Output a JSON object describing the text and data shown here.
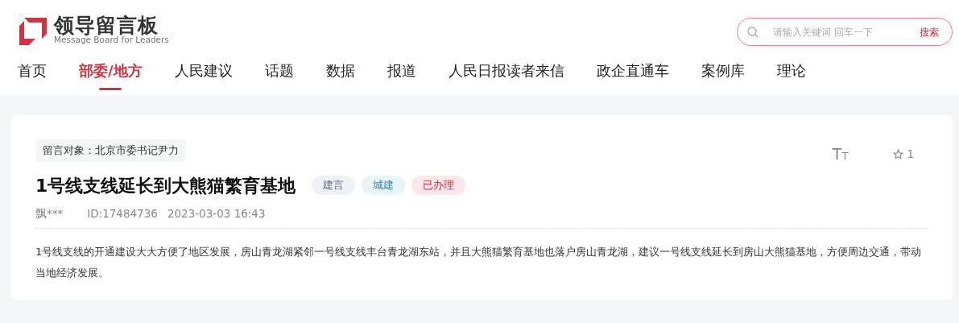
{
  "logo": {
    "title": "领导留言板",
    "subtitle": "Message Board for Leaders"
  },
  "search": {
    "placeholder": "请输入关键词 回车一下",
    "button": "搜索"
  },
  "nav": [
    {
      "label": "首页",
      "selected": false
    },
    {
      "label": "部委/地方",
      "selected": true
    },
    {
      "label": "人民建议",
      "selected": false
    },
    {
      "label": "话题",
      "selected": false
    },
    {
      "label": "数据",
      "selected": false
    },
    {
      "label": "报道",
      "selected": false
    },
    {
      "label": "人民日报读者来信",
      "selected": false
    },
    {
      "label": "政企直通车",
      "selected": false
    },
    {
      "label": "案例库",
      "selected": false
    },
    {
      "label": "理论",
      "selected": false
    }
  ],
  "message": {
    "recipient": "留言对象：北京市委书记尹力",
    "font_size_button": "TT",
    "favorites": "1",
    "title": "1号线支线延长到大熊猫繁育基地",
    "tags": [
      {
        "label": "建言",
        "color": "#eef1f6",
        "kind": "type"
      },
      {
        "label": "城建",
        "color": "#e8f6f7",
        "kind": "field"
      },
      {
        "label": "已办理",
        "color": "#fce8eb",
        "kind": "status"
      }
    ],
    "author": "飘***",
    "id": "ID:17484736",
    "time": "2023-03-03 16:43",
    "body": "1号线支线的开通建设大大方便了地区发展，房山青龙湖紧邻一号线支线丰台青龙湖东站，并且大熊猫繁育基地也落户房山青龙湖，建议一号线支线延长到房山大熊猫基地，方便周边交通，带动当地经济发展。"
  }
}
